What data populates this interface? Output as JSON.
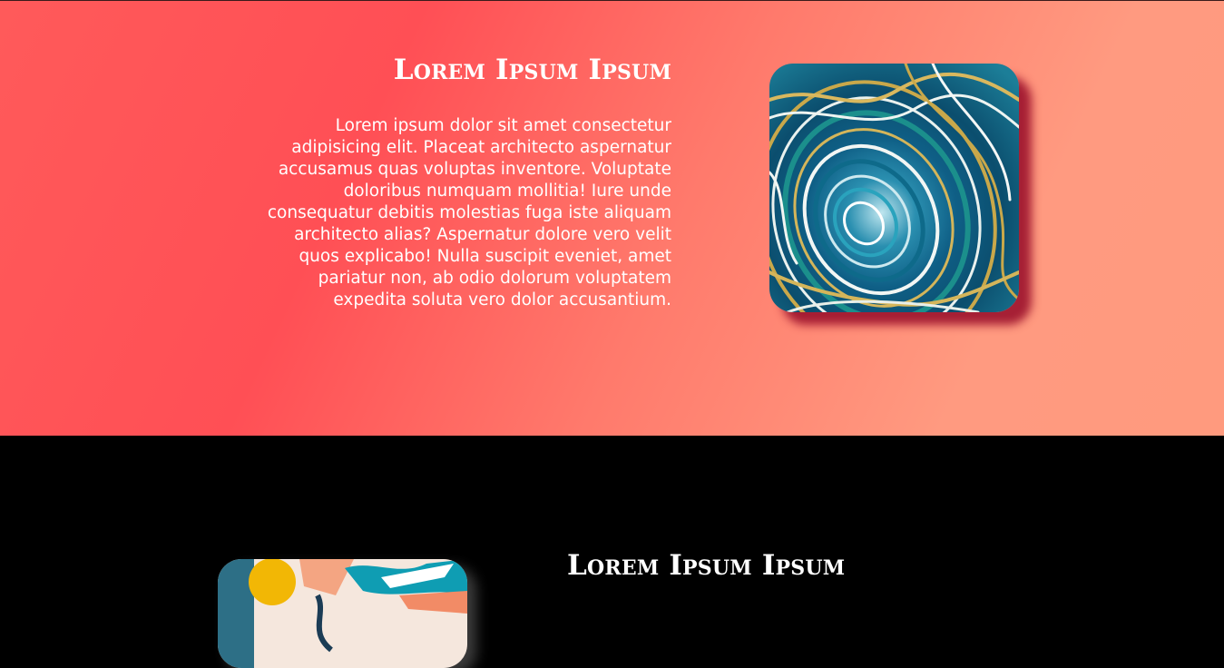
{
  "sections": {
    "first": {
      "heading": "Lorem Ipsum Ipsum",
      "paragraph": "Lorem ipsum dolor sit amet consectetur adipisicing elit. Placeat architecto aspernatur accusamus quas voluptas inventore. Voluptate doloribus numquam mollitia! Iure unde consequatur debitis molestias fuga iste aliquam architecto alias? Aspernatur dolore vero velit quos explicabo! Nulla suscipit eveniet, amet pariatur non, ab odio dolorum voluptatem expedita soluta vero dolor accusantium.",
      "image": "marble-swirl-artwork",
      "background_colors": [
        "#ff4f55",
        "#ff9a7e"
      ]
    },
    "second": {
      "heading": "Lorem Ipsum Ipsum",
      "image": "paint-splash-artwork",
      "background_color": "#000000"
    }
  }
}
